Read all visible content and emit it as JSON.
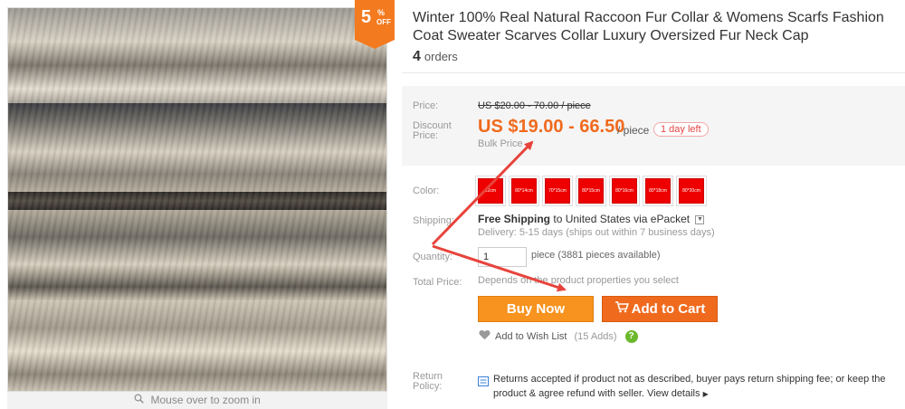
{
  "badge": {
    "number": "5",
    "percent": "%",
    "off": "OFF"
  },
  "zoom": {
    "label": "Mouse over to zoom in"
  },
  "product": {
    "title": "Winter 100% Real Natural Raccoon Fur Collar & Womens Scarfs Fashion Coat Sweater Scarves Collar Luxury Oversized Fur Neck Cap",
    "orders_count": "4",
    "orders_label": "orders"
  },
  "price": {
    "price_label": "Price:",
    "original": "US $20.00 - 70.00 / piece",
    "discount_label_1": "Discount",
    "discount_label_2": "Price:",
    "discounted": "US $19.00 - 66.50",
    "per_piece": "/ piece",
    "time_left": "1 day left",
    "bulk": "Bulk Price"
  },
  "color": {
    "label": "Color:",
    "swatches": [
      "12cm",
      "80*14cm",
      "70*15cm",
      "80*15cm",
      "80*16cm",
      "80*18cm",
      "80*20cm"
    ],
    "swatch_color": "#ee0000"
  },
  "shipping": {
    "label": "Shipping:",
    "free": "Free Shipping",
    "to": "to",
    "destination": "United States via ePacket",
    "delivery": "Delivery: 5-15 days (ships out within 7 business days)"
  },
  "quantity": {
    "label": "Quantity:",
    "value": "1",
    "note": "piece (3881 pieces available)"
  },
  "total": {
    "label": "Total Price:",
    "note": "Depends on the product properties you select"
  },
  "buttons": {
    "buy_now": "Buy Now",
    "add_to_cart": "Add to Cart",
    "buy_color": "#f7931e",
    "cart_color": "#f06a1e"
  },
  "wishlist": {
    "label": "Add to Wish List",
    "count": "(15 Adds)",
    "help": "?"
  },
  "return_policy": {
    "label_1": "Return",
    "label_2": "Policy:",
    "text": "Returns accepted if product not as described, buyer pays return shipping fee; or keep the product & agree refund with seller.",
    "link": "View details"
  },
  "colors": {
    "accent_orange": "#f06a1e",
    "annotation_red": "#e8433b"
  }
}
